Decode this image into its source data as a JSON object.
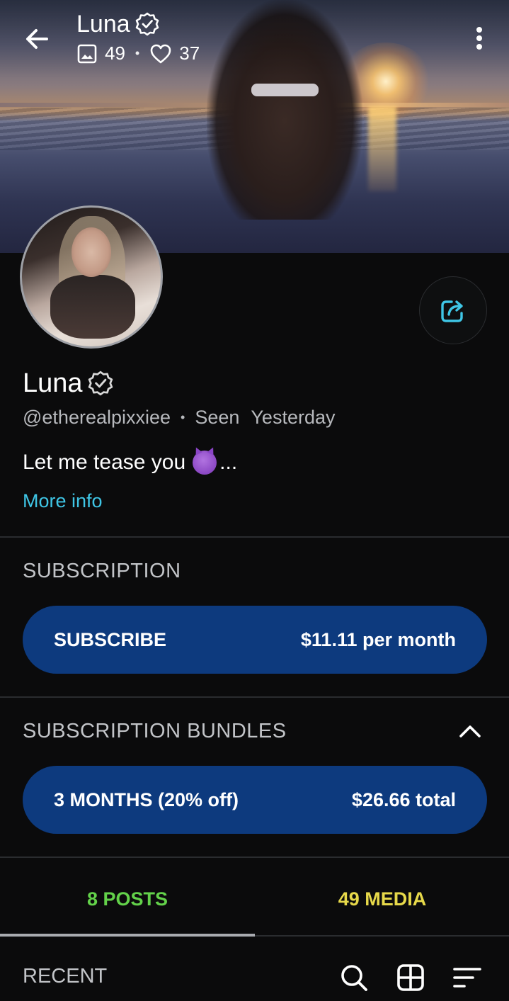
{
  "header": {
    "title": "Luna",
    "images_count": "49",
    "likes_count": "37",
    "dot": "•"
  },
  "profile": {
    "name": "Luna",
    "handle": "@etherealpixxiee",
    "separator": "•",
    "seen_label": "Seen",
    "seen_value": "Yesterday",
    "bio": "Let me tease you",
    "bio_suffix": "...",
    "more_info": "More info"
  },
  "subscription": {
    "title": "SUBSCRIPTION",
    "button_label": "SUBSCRIBE",
    "button_price": "$11.11 per month"
  },
  "bundles": {
    "title": "SUBSCRIPTION BUNDLES",
    "items": [
      {
        "label": "3 MONTHS (20% off)",
        "price": "$26.66 total"
      }
    ]
  },
  "tabs": {
    "posts": "8 POSTS",
    "media": "49 MEDIA",
    "active": "posts"
  },
  "recent": {
    "label": "RECENT"
  },
  "icons": {
    "back": "back-arrow-icon",
    "verified": "verified-badge-icon",
    "image": "image-icon",
    "heart": "heart-icon",
    "more": "more-vertical-icon",
    "share": "share-icon",
    "chevron": "chevron-up-icon",
    "search": "search-icon",
    "grid": "grid-icon",
    "sort": "sort-icon"
  },
  "colors": {
    "background": "#0b0b0c",
    "accent_link": "#3fc6e6",
    "pill": "#0d3a7e",
    "posts_tab": "#63d24a",
    "media_tab": "#e7d94a"
  }
}
